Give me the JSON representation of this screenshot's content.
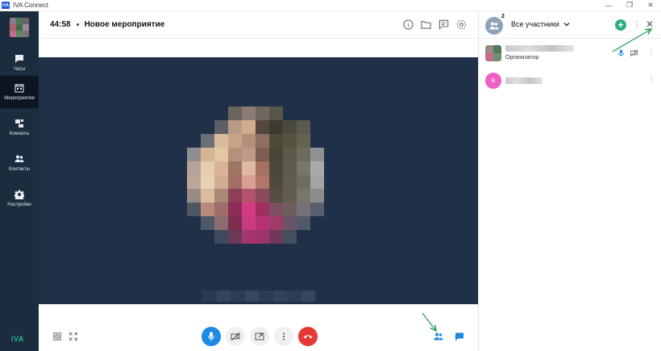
{
  "window": {
    "logo_text": "IVA",
    "title": "IVA Connect",
    "minimize_label": "—",
    "restore_label": "❐",
    "close_label": "✕"
  },
  "sidebar": {
    "items": [
      {
        "label": "Чаты",
        "icon": "chat-icon",
        "active": false
      },
      {
        "label": "Мероприятия",
        "icon": "calendar-icon",
        "active": true
      },
      {
        "label": "Комнаты",
        "icon": "rooms-icon",
        "active": false
      },
      {
        "label": "Контакты",
        "icon": "contacts-icon",
        "active": false
      },
      {
        "label": "Настройки",
        "icon": "gear-icon",
        "active": false
      }
    ],
    "brand": "IVA"
  },
  "header": {
    "timer": "44:58",
    "title": "Новое мероприятие",
    "icons": [
      "info-icon",
      "folder-icon",
      "notes-icon",
      "settings-icon"
    ]
  },
  "controls": {
    "left_icons": [
      "grid-layout-icon",
      "fullscreen-icon"
    ],
    "center_buttons": [
      "microphone-icon",
      "camera-off-icon",
      "share-screen-icon",
      "more-icon",
      "hang-up-icon"
    ],
    "right_icons": [
      "participants-icon",
      "chat-icon"
    ]
  },
  "panel": {
    "participant_count": "2",
    "filter_label": "Все участники",
    "add_label": "+",
    "more_label": "⋮",
    "close_label": "✕",
    "participants": [
      {
        "role": "Организатор",
        "avatar_letter": ""
      },
      {
        "role": "",
        "avatar_letter": "B"
      }
    ]
  },
  "colors": {
    "sidebar_bg": "#1b2c3f",
    "video_bg": "#1f3048",
    "accent_blue": "#1e88e5",
    "hangup_red": "#e53935",
    "add_green": "#2eaf7f",
    "brand_green": "#2eb398",
    "annotation_arrow": "#1f9d4c"
  }
}
